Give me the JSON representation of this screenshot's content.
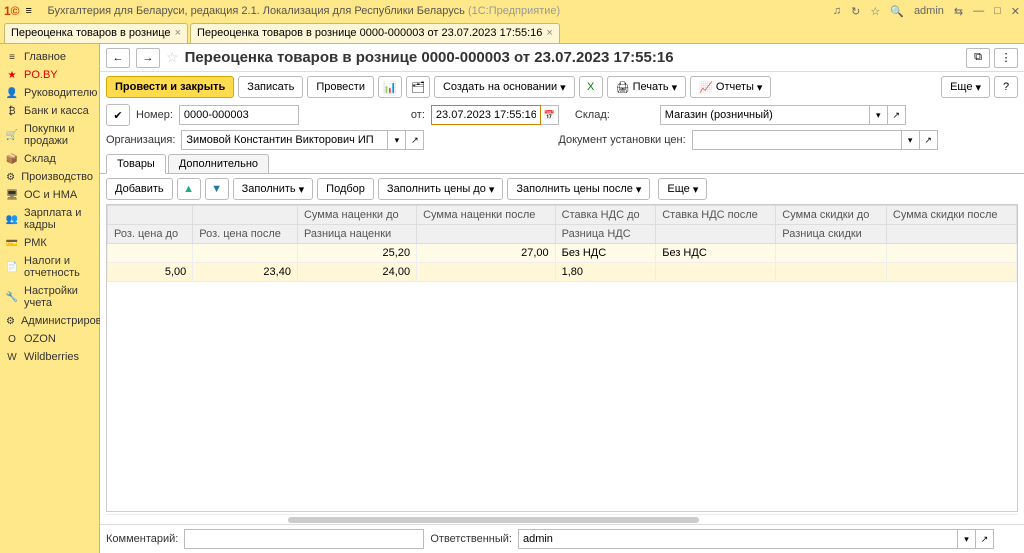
{
  "titlebar": {
    "app": "Бухгалтерия для Беларуси, редакция 2.1. Локализация для Республики Беларусь",
    "mode": "(1С:Предприятие)",
    "user": "admin"
  },
  "tabs": [
    {
      "label": "Переоценка товаров в рознице"
    },
    {
      "label": "Переоценка товаров в рознице 0000-000003 от 23.07.2023 17:55:16"
    }
  ],
  "sidebar": [
    {
      "label": "Главное",
      "icon": "≡"
    },
    {
      "label": "PO.BY",
      "icon": "★"
    },
    {
      "label": "Руководителю",
      "icon": "👤"
    },
    {
      "label": "Банк и касса",
      "icon": "₿"
    },
    {
      "label": "Покупки и продажи",
      "icon": "🛒"
    },
    {
      "label": "Склад",
      "icon": "📦"
    },
    {
      "label": "Производство",
      "icon": "⚙"
    },
    {
      "label": "ОС и НМА",
      "icon": "🖥"
    },
    {
      "label": "Зарплата и кадры",
      "icon": "👥"
    },
    {
      "label": "РМК",
      "icon": "💳"
    },
    {
      "label": "Налоги и отчетность",
      "icon": "📄"
    },
    {
      "label": "Настройки учета",
      "icon": "🔧"
    },
    {
      "label": "Администрирование",
      "icon": "⚙"
    },
    {
      "label": "OZON",
      "icon": "O"
    },
    {
      "label": "Wildberries",
      "icon": "W"
    }
  ],
  "doc": {
    "title": "Переоценка товаров в рознице 0000-000003 от 23.07.2023 17:55:16",
    "actions": {
      "post_close": "Провести и закрыть",
      "write": "Записать",
      "post": "Провести",
      "create_based": "Создать на основании",
      "print": "Печать",
      "reports": "Отчеты",
      "more": "Еще"
    },
    "fields": {
      "number_label": "Номер:",
      "number": "0000-000003",
      "date_label": "от:",
      "date": "23.07.2023 17:55:16",
      "warehouse_label": "Склад:",
      "warehouse": "Магазин (розничный)",
      "org_label": "Организация:",
      "org": "Зимовой Константин Викторович ИП",
      "pricedoc_label": "Документ установки цен:"
    }
  },
  "tabs2": {
    "goods": "Товары",
    "extra": "Дополнительно"
  },
  "grid_actions": {
    "add": "Добавить",
    "fill": "Заполнить",
    "pick": "Подбор",
    "fill_before": "Заполнить цены до",
    "fill_after": "Заполнить цены после",
    "more": "Еще"
  },
  "grid": {
    "headers1": [
      "",
      "",
      "Сумма наценки до",
      "Сумма наценки после",
      "Ставка НДС до",
      "Ставка НДС после",
      "Сумма скидки до",
      "Сумма скидки после"
    ],
    "headers2": [
      "Роз. цена до",
      "Роз. цена после",
      "Разница наценки",
      "",
      "Разница НДС",
      "",
      "Разница скидки",
      ""
    ],
    "row1": [
      "",
      "",
      "25,20",
      "27,00",
      "Без НДС",
      "Без НДС",
      "",
      ""
    ],
    "row2": [
      "5,00",
      "23,40",
      "24,00",
      "",
      "1,80",
      "",
      "",
      ""
    ]
  },
  "footer": {
    "comment_label": "Комментарий:",
    "responsible_label": "Ответственный:",
    "responsible": "admin"
  }
}
